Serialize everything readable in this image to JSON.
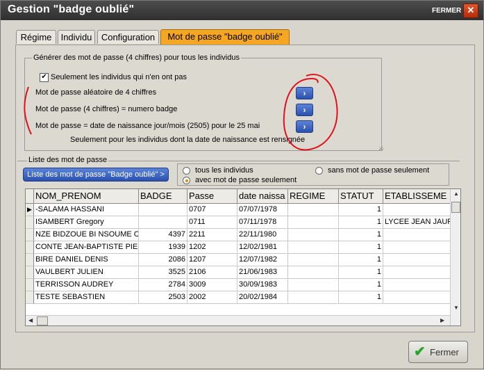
{
  "window": {
    "title": "Gestion \"badge oublié\"",
    "close_label": "FERMER",
    "close_glyph": "✕"
  },
  "tabs": [
    {
      "label": "Régime"
    },
    {
      "label": "Individu"
    },
    {
      "label": "Configuration"
    },
    {
      "label": "Mot de passe \"badge oublié\"",
      "active": true
    }
  ],
  "generate": {
    "legend": "Générer des mot de passe (4 chiffres) pour tous les individus",
    "checkbox_label": "Seulement les individus qui n'en ont pas",
    "checkbox_checked": true,
    "option1": "Mot de passe aléatoire de 4 chiffres",
    "option2": "Mot de passe (4 chiffres)  = numero badge",
    "option3": "Mot de passe = date de naissance jour/mois (2505) pour le 25 mai",
    "option3_note": "Seulement pour les individus dont la date de naissance est rensignée",
    "arrow_glyph": "›"
  },
  "list": {
    "legend": "Liste des mot de passe",
    "button_label": "Liste des mot de passe \"Badge oublié\" >",
    "radio_all": "tous les individus",
    "radio_without": "sans mot de passe seulement",
    "radio_with": "avec mot de passe seulement",
    "radio_selected": "avec mot de passe seulement"
  },
  "table": {
    "columns": [
      "NOM_PRENOM",
      "BADGE",
      "Passe",
      "date naissa",
      "REGIME",
      "STATUT",
      "ETABLISSEME"
    ],
    "rows": [
      [
        "-SALAMA HASSANI",
        "",
        "0707",
        "07/07/1978",
        "",
        "1",
        ""
      ],
      [
        "ISAMBERT Gregory",
        "",
        "0711",
        "07/11/1978",
        "",
        "1",
        "LYCEE JEAN JAUF"
      ],
      [
        "NZE BIDZOUE BI NSOUME Co",
        "4397",
        "2211",
        "22/11/1980",
        "",
        "1",
        ""
      ],
      [
        "CONTE JEAN-BAPTISTE PIEF",
        "1939",
        "1202",
        "12/02/1981",
        "",
        "1",
        ""
      ],
      [
        "BIRE DANIEL DENIS",
        "2086",
        "1207",
        "12/07/1982",
        "",
        "1",
        ""
      ],
      [
        "VAULBERT JULIEN",
        "3525",
        "2106",
        "21/06/1983",
        "",
        "1",
        ""
      ],
      [
        "TERRISSON AUDREY",
        "2784",
        "3009",
        "30/09/1983",
        "",
        "1",
        ""
      ],
      [
        "TESTE SEBASTIEN",
        "2503",
        "2002",
        "20/02/1984",
        "",
        "1",
        ""
      ]
    ],
    "current_row_marker": "▶"
  },
  "footer": {
    "close_button_label": "Fermer",
    "check_glyph": "✔"
  },
  "colors": {
    "active_tab": "#f5a623",
    "blue_button": "#2c51b0",
    "annotation_red": "#e0101a",
    "title_bar": "#3a3a3a"
  }
}
